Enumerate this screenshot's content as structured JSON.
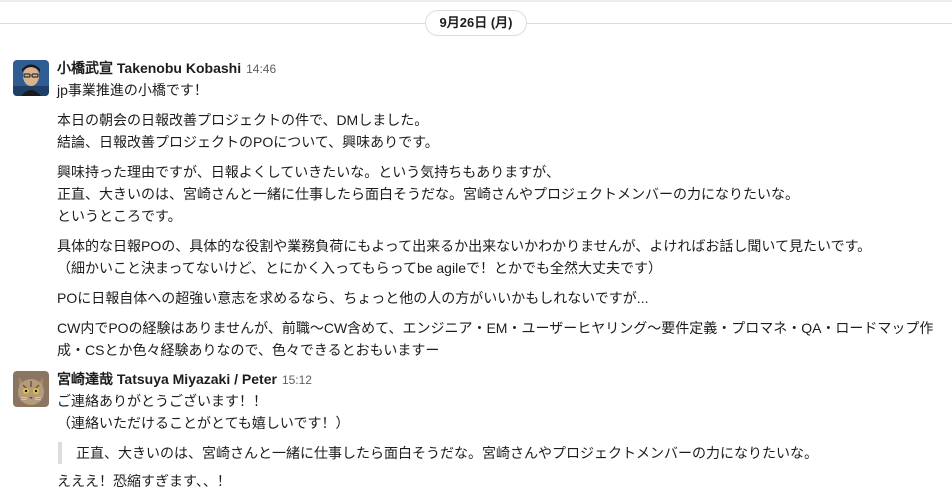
{
  "date_divider": {
    "label": "9月26日 (月)"
  },
  "messages": [
    {
      "author": "小橋武宣 Takenobu Kobashi",
      "time": "14:46",
      "paragraphs": [
        [
          "jp事業推進の小橋です！"
        ],
        [
          "本日の朝会の日報改善プロジェクトの件で、DMしました。",
          "結論、日報改善プロジェクトのPOについて、興味ありです。"
        ],
        [
          "興味持った理由ですが、日報よくしていきたいな。という気持ちもありますが、",
          "正直、大きいのは、宮崎さんと一緒に仕事したら面白そうだな。宮崎さんやプロジェクトメンバーの力になりたいな。",
          "というところです。"
        ],
        [
          "具体的な日報POの、具体的な役割や業務負荷にもよって出来るか出来ないかわかりませんが、よければお話し聞いて見たいです。",
          "（細かいこと決まってないけど、とにかく入ってもらってbe agileで！とかでも全然大丈夫です）"
        ],
        [
          "POに日報自体への超強い意志を求めるなら、ちょっと他の人の方がいいかもしれないですが..."
        ],
        [
          "CW内でPOの経験はありませんが、前職〜CW含めて、エンジニア・EM・ユーザーヒヤリング〜要件定義・プロマネ・QA・ロードマップ作",
          "成・CSとか色々経験ありなので、色々できるとおもいますー"
        ]
      ]
    },
    {
      "author": "宮崎達哉 Tatsuya Miyazaki / Peter",
      "time": "15:12",
      "lines": [
        "ご連絡ありがとうございます！！",
        "（連絡いただけることがとても嬉しいです！）"
      ],
      "quote": "正直、大きいのは、宮崎さんと一緒に仕事したら面白そうだな。宮崎さんやプロジェクトメンバーの力になりたいな。",
      "after_quote": "えええ！恐縮すぎます、、！"
    }
  ]
}
